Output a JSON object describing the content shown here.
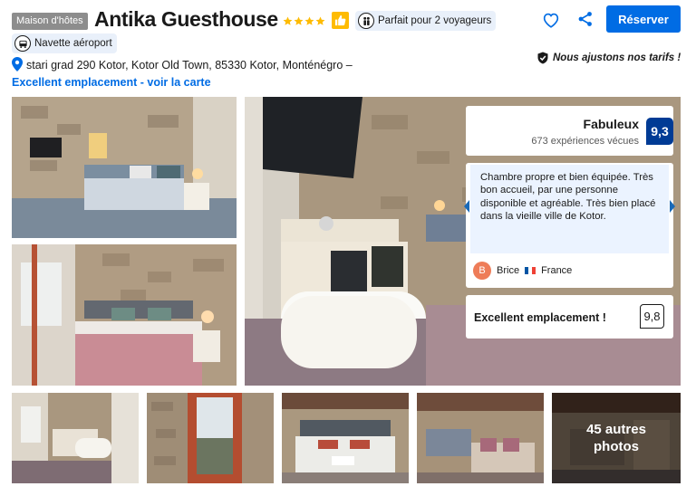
{
  "header": {
    "type_badge": "Maison d'hôtes",
    "title": "Antika Guesthouse",
    "stars": 4,
    "pill_voyageurs": "Parfait pour 2 voyageurs",
    "pill_navette": "Navette aéroport",
    "reserve_label": "Réserver"
  },
  "location": {
    "address": "stari grad 290 Kotor, Kotor Old Town, 85330 Kotor, Monténégro –",
    "map_link": "Excellent emplacement - voir la carte",
    "tarifs_note": "Nous ajustons nos tarifs !"
  },
  "review": {
    "score_label": "Fabuleux",
    "score_count": "673 expériences vécues",
    "score_value": "9,3",
    "quote": "Chambre propre et bien équipée. Très bon accueil, par une personne disponible et agréable. Très bien placé dans la vieille ville de Kotor.",
    "reviewer_initial": "B",
    "reviewer_name": "Brice",
    "reviewer_country": "France",
    "location_label": "Excellent emplacement !",
    "location_score": "9,8"
  },
  "photos": {
    "more_label_1": "45 autres",
    "more_label_2": "photos"
  },
  "colors": {
    "brand_blue": "#006ce4",
    "score_dark": "#003b95",
    "star_yellow": "#febb02",
    "quote_bg": "#ebf3ff"
  }
}
